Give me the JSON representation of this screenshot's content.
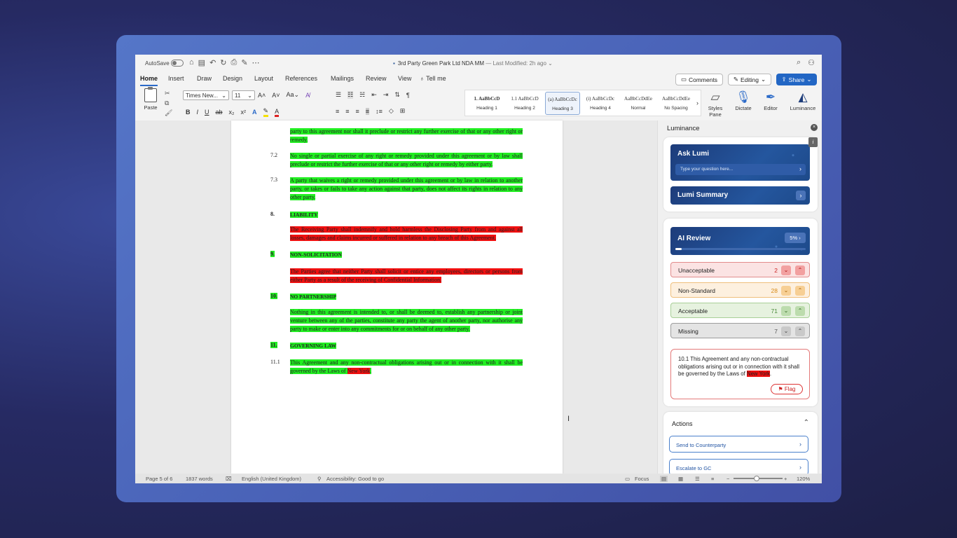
{
  "titlebar": {
    "autosave": "AutoSave",
    "doc_title": "3rd Party Green Park Ltd NDA MM",
    "modified": "— Last Modified: 2h ago ⌄"
  },
  "tabs": [
    "Home",
    "Insert",
    "Draw",
    "Design",
    "Layout",
    "References",
    "Mailings",
    "Review",
    "View",
    "Tell me"
  ],
  "buttons": {
    "comments": "Comments",
    "editing": "Editing",
    "share": "Share"
  },
  "ribbon": {
    "paste": "Paste",
    "font": "Times New...",
    "size": "11",
    "styles": [
      {
        "preview": "1. AaBbCcD",
        "name": "Heading 1"
      },
      {
        "preview": "1.1 AaBbCcD",
        "name": "Heading 2"
      },
      {
        "preview": "(a) AaBbCcDc",
        "name": "Heading 3"
      },
      {
        "preview": "(i) AaBbCcDc",
        "name": "Heading 4"
      },
      {
        "preview": "AaBbCcDdEe",
        "name": "Normal"
      },
      {
        "preview": "AaBbCcDdEe",
        "name": "No Spacing"
      }
    ],
    "styles_pane": "Styles Pane",
    "dictate": "Dictate",
    "editor": "Editor",
    "luminance": "Luminance"
  },
  "document": {
    "p0": "party to this agreement nor shall it preclude or restrict any further exercise of that or any other right or remedy.",
    "n72": "7.2",
    "p72": "No single or partial exercise of any right or remedy provided under this agreement or by law shall preclude or restrict the further exercise of that or any other right or remedy by either party.",
    "n73": "7.3",
    "p73": "A party that waives a right or remedy provided under this agreement or by law in relation to another party, or takes or fails to take any action against that party, does not affect its rights in relation to any other party.",
    "n8": "8.",
    "h8": "LIABILITY",
    "p8": "The Receiving Party shall indemnify and hold harmless the Disclosing Party from and against all losses, damages and claims incurred or suffered in relation to any breach of this Agreement.",
    "n9": "9.",
    "h9": "NON-SOLICITATION",
    "p9": "The Parties agree that neither Party shall solicit or entice any employees, directors or persons from either Party as a result of the receiving of Confidential Information.",
    "n10": "10.",
    "h10": "NO PARTNERSHIP",
    "p10": "Nothing in this agreement is intended to, or shall be deemed to, establish any partnership or joint venture between any of the parties, constitute any party the agent of another party, nor authorise any party to make or enter into any commitments for or on behalf of any other party.",
    "n11": "11.",
    "h11": "GOVERNING LAW",
    "n111": "11.1",
    "p111a": "This Agreement and any non-contractual obligations arising out or in connection with it shall be governed by the Laws of ",
    "p111b": "New York",
    "p111c": "."
  },
  "pane": {
    "title": "Luminance",
    "ask_title": "Ask Lumi",
    "ask_placeholder": "Type your question here...",
    "summary_title": "Lumi Summary",
    "ai_title": "AI Review",
    "ai_pct": "5%",
    "ai_progress": 0.05,
    "categories": [
      {
        "label": "Unacceptable",
        "count": "2"
      },
      {
        "label": "Non-Standard",
        "count": "28"
      },
      {
        "label": "Acceptable",
        "count": "71"
      },
      {
        "label": "Missing",
        "count": "7"
      }
    ],
    "clause_text": "10.1 This Agreement and any non-contractual obligations arising out or in connection with it shall be governed by the Laws of ",
    "clause_highlight": "New York",
    "clause_end": ".",
    "flag": "Flag",
    "actions_title": "Actions",
    "action1": "Send to Counterparty",
    "action2": "Escalate to GC"
  },
  "status": {
    "page": "Page 5 of 6",
    "words": "1837 words",
    "language": "English (United Kingdom)",
    "accessibility": "Accessibility: Good to go",
    "focus": "Focus",
    "zoom": "120%"
  },
  "colors": {
    "highlight_green": "#22ee22",
    "highlight_red": "#f01010",
    "accent": "#2266c4"
  }
}
